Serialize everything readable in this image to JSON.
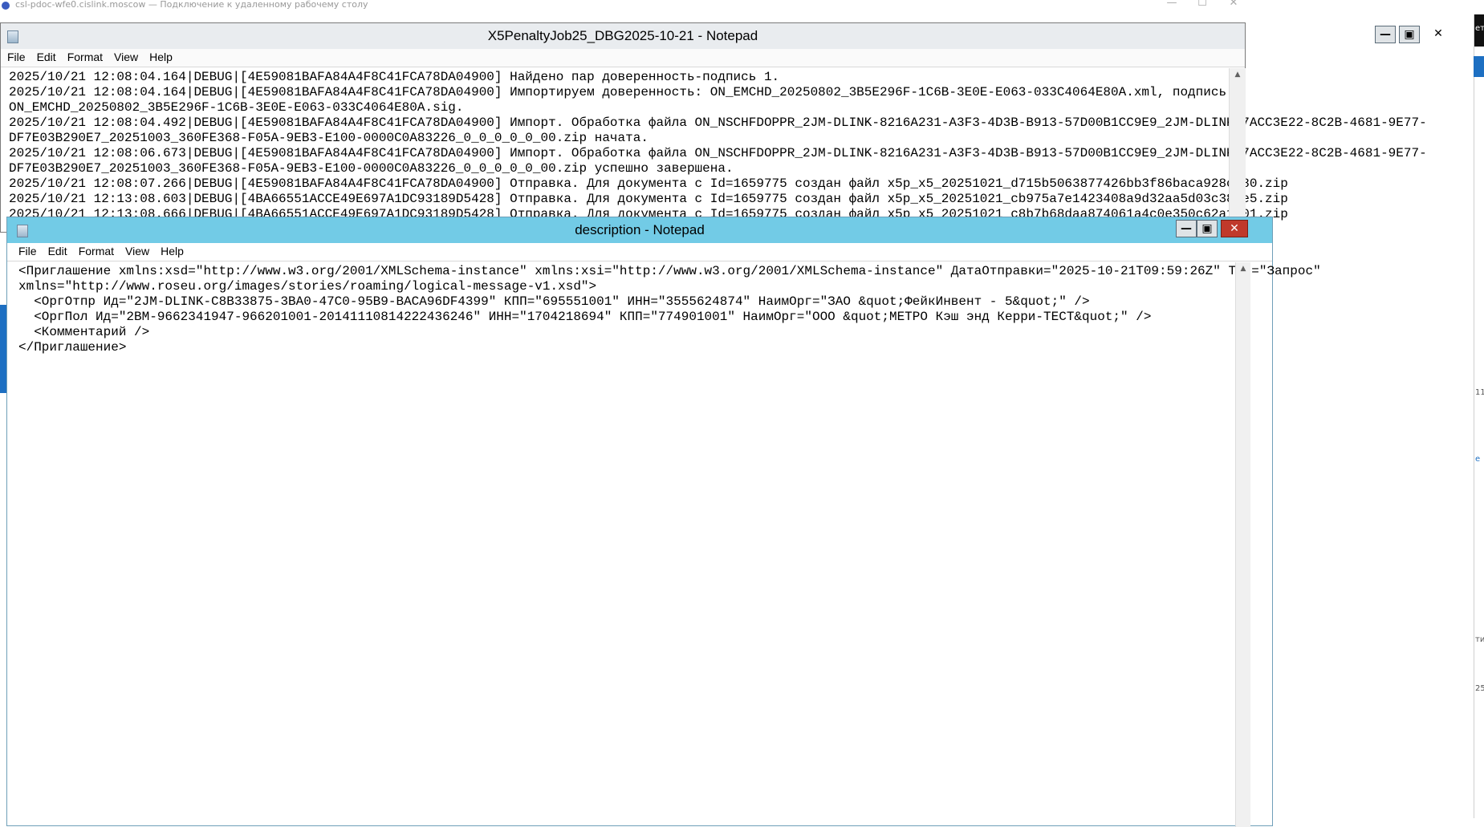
{
  "rdp": {
    "title": "csl-pdoc-wfe0.cislink.moscow — Подключение к удаленному рабочему столу",
    "minimize": "—",
    "maximize": "☐",
    "close": "✕"
  },
  "back_window": {
    "title": "X5PenaltyJob25_DBG2025-10-21 - Notepad",
    "menu": [
      "File",
      "Edit",
      "Format",
      "View",
      "Help"
    ],
    "lines": [
      "2025/10/21 12:08:04.164|DEBUG|[4E59081BAFA84A4F8C41FCA78DA04900] Найдено пар доверенность-подпись 1.",
      "2025/10/21 12:08:04.164|DEBUG|[4E59081BAFA84A4F8C41FCA78DA04900] Импортируем доверенность: ON_EMCHD_20250802_3B5E296F-1C6B-3E0E-E063-033C4064E80A.xml, подпись:",
      "ON_EMCHD_20250802_3B5E296F-1C6B-3E0E-E063-033C4064E80A.sig.",
      "2025/10/21 12:08:04.492|DEBUG|[4E59081BAFA84A4F8C41FCA78DA04900] Импорт. Обработка файла ON_NSCHFDOPPR_2JM-DLINK-8216A231-A3F3-4D3B-B913-57D00B1CC9E9_2JM-DLINK-7ACC3E22-8C2B-4681-9E77-",
      "DF7E03B290E7_20251003_360FE368-F05A-9EB3-E100-0000C0A83226_0_0_0_0_0_00.zip начата.",
      "2025/10/21 12:08:06.673|DEBUG|[4E59081BAFA84A4F8C41FCA78DA04900] Импорт. Обработка файла ON_NSCHFDOPPR_2JM-DLINK-8216A231-A3F3-4D3B-B913-57D00B1CC9E9_2JM-DLINK-7ACC3E22-8C2B-4681-9E77-",
      "DF7E03B290E7_20251003_360FE368-F05A-9EB3-E100-0000C0A83226_0_0_0_0_0_00.zip успешно завершена.",
      "2025/10/21 12:08:07.266|DEBUG|[4E59081BAFA84A4F8C41FCA78DA04900] Отправка. Для документа с Id=1659775 создан файл x5p_x5_20251021_d715b5063877426bb3f86baca928c180.zip",
      "2025/10/21 12:13:08.603|DEBUG|[4BA66551ACCE49E697A1DC93189D5428] Отправка. Для документа с Id=1659775 создан файл x5p_x5_20251021_cb975a7e1423408a9d32aa5d03c38ce5.zip",
      "2025/10/21 12:13:08.666|DEBUG|[4BA66551ACCE49E697A1DC93189D5428] Отправка. Для документа с Id=1659775 создан файл x5p_x5_20251021_c8b7b68daa874061a4c0e350c62a1d01.zip"
    ]
  },
  "front_window": {
    "title": "description - Notepad",
    "menu": [
      "File",
      "Edit",
      "Format",
      "View",
      "Help"
    ],
    "lines": [
      "<Приглашение xmlns:xsd=\"http://www.w3.org/2001/XMLSchema-instance\" xmlns:xsi=\"http://www.w3.org/2001/XMLSchema-instance\" ДатаОтправки=\"2025-10-21T09:59:26Z\" Тип=\"Запрос\"",
      "xmlns=\"http://www.roseu.org/images/stories/roaming/logical-message-v1.xsd\">",
      "  <ОргОтпр Ид=\"2JM-DLINK-C8B33875-3BA0-47C0-95B9-BACA96DF4399\" КПП=\"695551001\" ИНН=\"3555624874\" НаимОрг=\"ЗАО &quot;ФейкИнвент - 5&quot;\" />",
      "  <ОргПол Ид=\"2BM-9662341947-966201001-20141110814222436246\" ИНН=\"1704218694\" КПП=\"774901001\" НаимОрг=\"ООО &quot;МЕТРО Кэш энд Керри-ТЕСТ&quot;\" />",
      "  <Комментарий />",
      "</Приглашение>"
    ]
  },
  "window_controls": {
    "minimize": "—",
    "maximize": "▣",
    "close": "✕"
  },
  "desktop_fragments": [
    "ет",
    "11",
    "е",
    "ти",
    "25"
  ]
}
